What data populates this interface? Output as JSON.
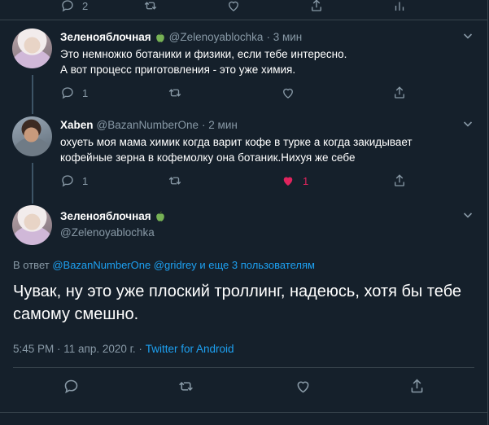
{
  "top_actions": {
    "reply_count": "2"
  },
  "tweets": [
    {
      "name": "Зеленояблочная",
      "handle": "@Zelenoyablochka",
      "time": "· 3 мин",
      "lines": [
        "Это немножко ботаники и физики, если тебе интересно.",
        "А вот процесс приготовления - это уже химия."
      ],
      "reply_count": "1",
      "like_count": ""
    },
    {
      "name": "Xaben",
      "handle": "@BazanNumberOne",
      "time": "· 2 мин",
      "lines": [
        "охуеть моя мама химик когда варит кофе в турке а когда закидывает",
        "кофейные зерна в кофемолку она ботаник.Нихуя же себе"
      ],
      "reply_count": "1",
      "like_count": "1"
    }
  ],
  "focused": {
    "name": "Зеленояблочная",
    "handle": "@Zelenoyablochka",
    "replying_prefix": "В ответ",
    "replying_links": "@BazanNumberOne @gridrey",
    "replying_suffix": "и еще 3 пользователям",
    "text": "Чувак, ну это уже плоский троллинг, надеюсь, хотя бы тебе самому смешно.",
    "time": "5:45 PM · 11 апр. 2020 г. ·",
    "source": "Twitter for Android"
  },
  "icons": {
    "reply": "reply-icon",
    "retweet": "retweet-icon",
    "like": "heart-icon",
    "share": "share-icon",
    "stats": "stats-icon",
    "more": "chevron-down-icon",
    "badge": "green-apple-emoji"
  },
  "colors": {
    "background": "#15202b",
    "muted": "#8899a6",
    "link": "#1da1f2",
    "like": "#e0245e",
    "apple": "#77b255"
  }
}
